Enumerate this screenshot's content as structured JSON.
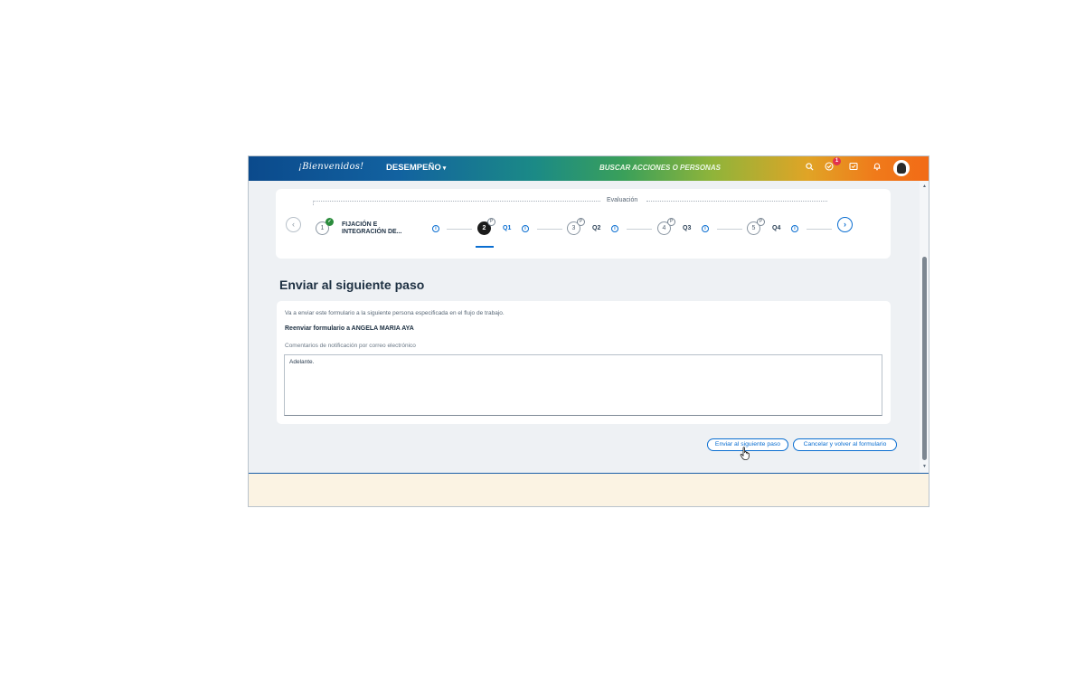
{
  "header": {
    "logo_text": "¡Bienvenidos!",
    "menu_label": "DESEMPEÑO",
    "search_label": "BUSCAR ACCIONES O PERSONAS",
    "notification_count": "1",
    "icons": [
      "search-icon",
      "todo-check-icon",
      "inbox-icon",
      "bell-icon",
      "avatar"
    ]
  },
  "stepper": {
    "group_label": "Evaluación",
    "steps": [
      {
        "number": "1",
        "label": "FIJACIÓN E INTEGRACIÓN DE...",
        "status": "completed"
      },
      {
        "number": "2",
        "label": "Q1",
        "status": "active"
      },
      {
        "number": "3",
        "label": "Q2",
        "status": "pending"
      },
      {
        "number": "4",
        "label": "Q3",
        "status": "pending"
      },
      {
        "number": "5",
        "label": "Q4",
        "status": "pending"
      }
    ],
    "step1_line1": "FIJACIÓN E",
    "step1_line2": "INTEGRACIÓN DE...",
    "pending_mark": "P"
  },
  "page": {
    "title": "Enviar al siguiente paso",
    "description": "Va a enviar este formulario a la siguiente persona especificada en el flujo de trabajo.",
    "forward_to": "Reenviar formulario a ANGELA MARIA AYA",
    "comments_label": "Comentarios de notificación por correo electrónico",
    "comments_value": "Adelante."
  },
  "actions": {
    "send_label": "Enviar al siguiente paso",
    "cancel_label": "Cancelar y volver al formulario"
  },
  "colors": {
    "accent": "#0a6ed1",
    "completed": "#2a8c3c",
    "badge": "#e2324f"
  }
}
